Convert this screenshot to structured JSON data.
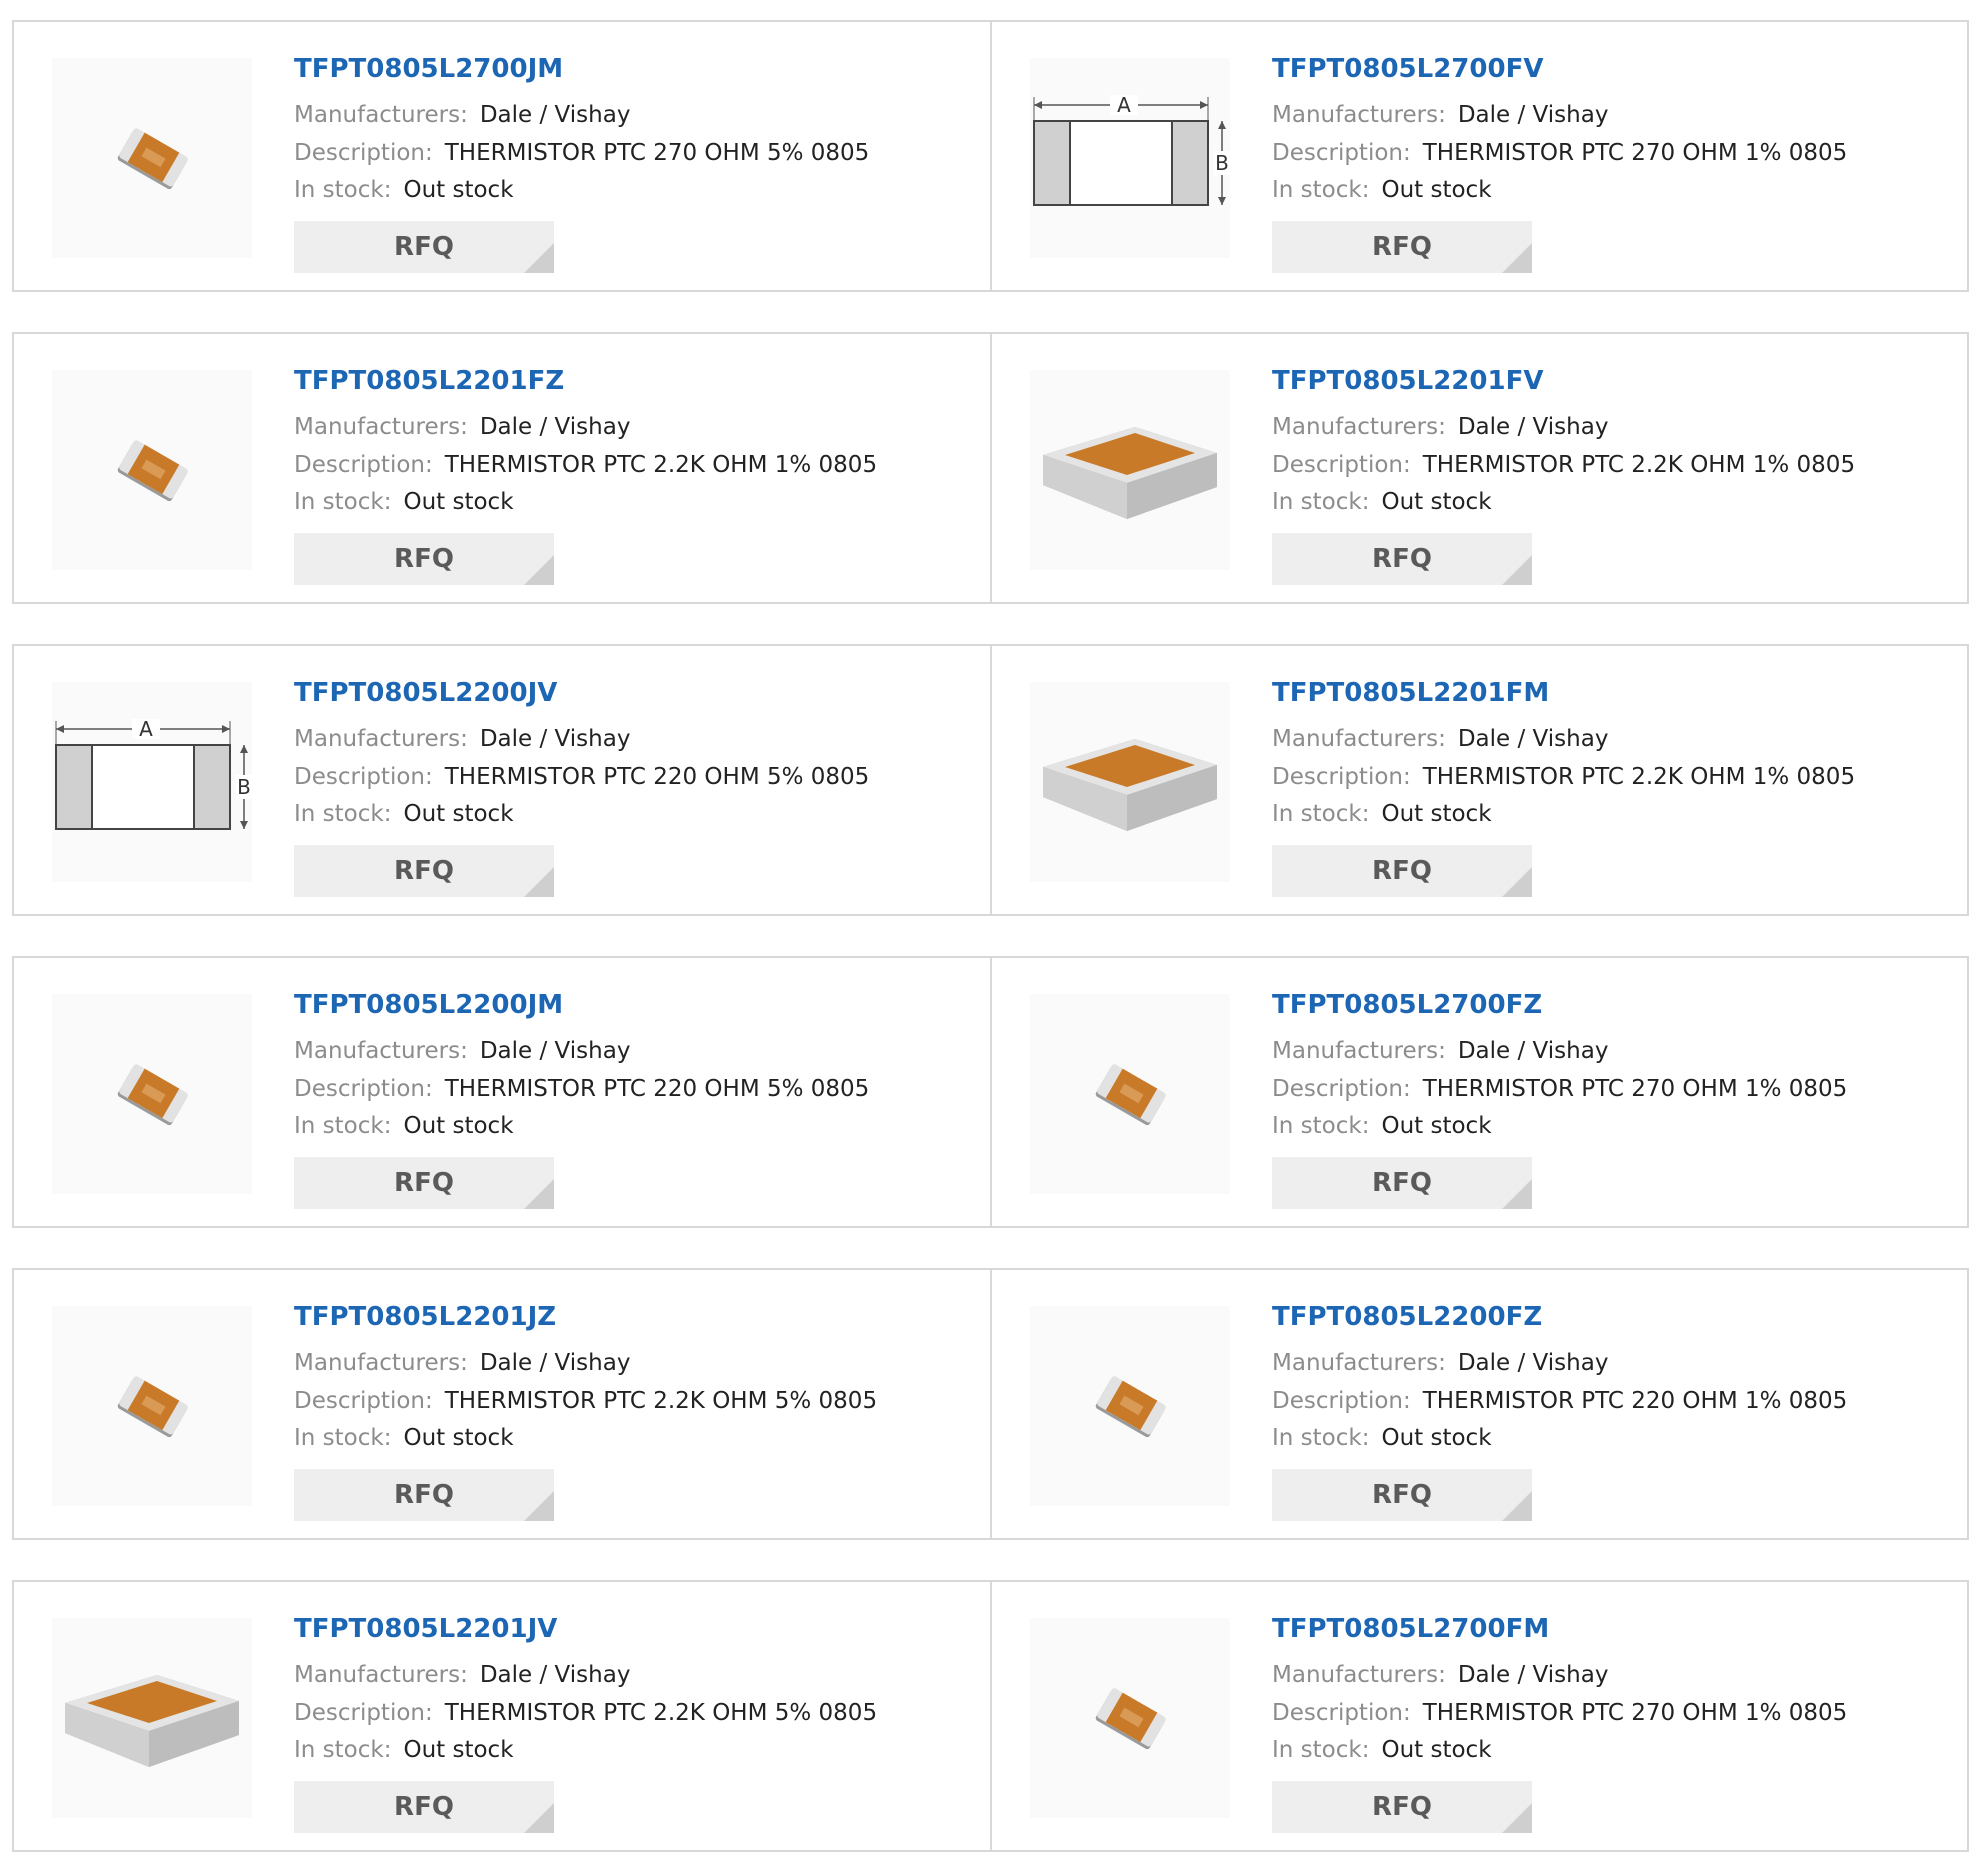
{
  "labels": {
    "manufacturers": "Manufacturers:",
    "description": "Description:",
    "stock": "In stock:",
    "rfq": "RFQ"
  },
  "colors": {
    "title": "#1d66b4",
    "border": "#d8d8d8",
    "button_bg": "#eeeeee",
    "chip_body": "#c97a28"
  },
  "products": [
    {
      "part": "TFPT0805L2700JM",
      "manufacturer": "Dale / Vishay",
      "description": "THERMISTOR PTC 270 OHM 5% 0805",
      "stock": "Out stock",
      "image": "small-chip-icon"
    },
    {
      "part": "TFPT0805L2700FV",
      "manufacturer": "Dale / Vishay",
      "description": "THERMISTOR PTC 270 OHM 1% 0805",
      "stock": "Out stock",
      "image": "dimension-diagram-icon",
      "image_text": [
        "A",
        "B"
      ]
    },
    {
      "part": "TFPT0805L2201FZ",
      "manufacturer": "Dale / Vishay",
      "description": "THERMISTOR PTC 2.2K OHM 1% 0805",
      "stock": "Out stock",
      "image": "small-chip-icon"
    },
    {
      "part": "TFPT0805L2201FV",
      "manufacturer": "Dale / Vishay",
      "description": "THERMISTOR PTC 2.2K OHM 1% 0805",
      "stock": "Out stock",
      "image": "large-chip-icon"
    },
    {
      "part": "TFPT0805L2200JV",
      "manufacturer": "Dale / Vishay",
      "description": "THERMISTOR PTC 220 OHM 5% 0805",
      "stock": "Out stock",
      "image": "dimension-diagram-icon",
      "image_text": [
        "A",
        "B"
      ]
    },
    {
      "part": "TFPT0805L2201FM",
      "manufacturer": "Dale / Vishay",
      "description": "THERMISTOR PTC 2.2K OHM 1% 0805",
      "stock": "Out stock",
      "image": "large-chip-icon"
    },
    {
      "part": "TFPT0805L2200JM",
      "manufacturer": "Dale / Vishay",
      "description": "THERMISTOR PTC 220 OHM 5% 0805",
      "stock": "Out stock",
      "image": "small-chip-icon"
    },
    {
      "part": "TFPT0805L2700FZ",
      "manufacturer": "Dale / Vishay",
      "description": "THERMISTOR PTC 270 OHM 1% 0805",
      "stock": "Out stock",
      "image": "small-chip-icon"
    },
    {
      "part": "TFPT0805L2201JZ",
      "manufacturer": "Dale / Vishay",
      "description": "THERMISTOR PTC 2.2K OHM 5% 0805",
      "stock": "Out stock",
      "image": "small-chip-icon"
    },
    {
      "part": "TFPT0805L2200FZ",
      "manufacturer": "Dale / Vishay",
      "description": "THERMISTOR PTC 220 OHM 1% 0805",
      "stock": "Out stock",
      "image": "small-chip-icon"
    },
    {
      "part": "TFPT0805L2201JV",
      "manufacturer": "Dale / Vishay",
      "description": "THERMISTOR PTC 2.2K OHM 5% 0805",
      "stock": "Out stock",
      "image": "large-chip-icon"
    },
    {
      "part": "TFPT0805L2700FM",
      "manufacturer": "Dale / Vishay",
      "description": "THERMISTOR PTC 270 OHM 1% 0805",
      "stock": "Out stock",
      "image": "small-chip-icon"
    }
  ]
}
